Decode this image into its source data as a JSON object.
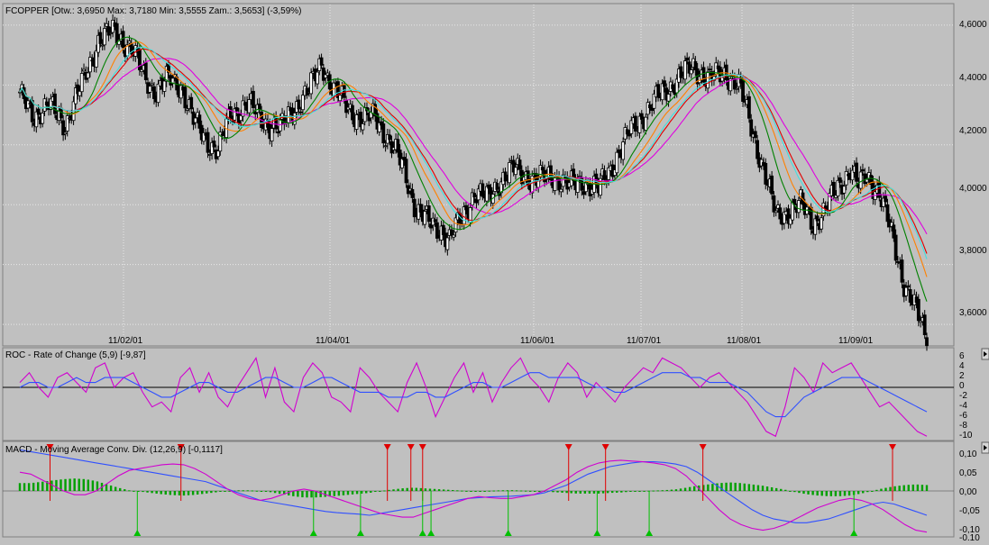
{
  "price_pane": {
    "title": "FCOPPER [Otw.: 3,6950  Max: 3,7180  Min: 3,5555  Zam.: 3,5653] (-3,59%)",
    "y_ticks": [
      "4,6000",
      "4,4000",
      "4,2000",
      "4,0000",
      "3,8000",
      "3,6000"
    ],
    "x_ticks": [
      "11/02/01",
      "11/04/01",
      "11/06/01",
      "11/07/01",
      "11/08/01",
      "11/09/01"
    ]
  },
  "roc_pane": {
    "title": "ROC - Rate of Change (5,9) [-9,87]",
    "y_ticks": [
      "6",
      "4",
      "2",
      "0",
      "-2",
      "-4",
      "-6",
      "-8",
      "-10"
    ]
  },
  "macd_pane": {
    "title": "MACD - Moving Average Conv. Div. (12,26,9) [-0,1117]",
    "y_ticks": [
      "0,10",
      "0,05",
      "0,00",
      "-0,05",
      "-0,10",
      "-0,10"
    ]
  },
  "colors": {
    "background": "#c0c0c0",
    "candle": "#000000",
    "ma_magenta": "#e000e0",
    "ma_red": "#e00000",
    "ma_orange": "#ff8000",
    "ma_green": "#008000",
    "ma_cyan": "#40e0e0",
    "roc": "#d000d0",
    "roc_signal": "#3050ff",
    "histogram": "#00a000",
    "sell": "#e00000",
    "buy": "#00c000"
  },
  "chart_data": [
    {
      "type": "candlestick",
      "title": "FCOPPER [Otw.: 3,6950  Max: 3,7180  Min: 3,5555  Zam.: 3,5653] (-3,59%)",
      "x_ticks": [
        "11/02/01",
        "11/04/01",
        "11/06/01",
        "11/07/01",
        "11/08/01",
        "11/09/01"
      ],
      "ylim": [
        3.54,
        4.66
      ],
      "close_path": [
        [
          0,
          4.36
        ],
        [
          7,
          4.3
        ],
        [
          14,
          4.33
        ],
        [
          22,
          4.27
        ],
        [
          30,
          4.4
        ],
        [
          38,
          4.55
        ],
        [
          46,
          4.58
        ],
        [
          54,
          4.52
        ],
        [
          60,
          4.43
        ],
        [
          66,
          4.38
        ],
        [
          72,
          4.42
        ],
        [
          78,
          4.4
        ],
        [
          84,
          4.28
        ],
        [
          90,
          4.22
        ],
        [
          96,
          4.18
        ],
        [
          102,
          4.3
        ],
        [
          110,
          4.34
        ],
        [
          118,
          4.28
        ],
        [
          126,
          4.25
        ],
        [
          132,
          4.32
        ],
        [
          140,
          4.38
        ],
        [
          146,
          4.48
        ],
        [
          152,
          4.38
        ],
        [
          160,
          4.32
        ],
        [
          166,
          4.28
        ],
        [
          172,
          4.3
        ],
        [
          178,
          4.22
        ],
        [
          186,
          4.12
        ],
        [
          192,
          3.98
        ],
        [
          198,
          3.94
        ],
        [
          204,
          3.92
        ],
        [
          208,
          3.88
        ],
        [
          214,
          3.96
        ],
        [
          220,
          4.04
        ],
        [
          226,
          4.02
        ],
        [
          232,
          4.08
        ],
        [
          240,
          4.12
        ],
        [
          250,
          4.08
        ],
        [
          258,
          4.1
        ],
        [
          266,
          4.06
        ],
        [
          272,
          4.08
        ],
        [
          280,
          4.05
        ],
        [
          288,
          4.15
        ],
        [
          296,
          4.25
        ],
        [
          304,
          4.32
        ],
        [
          312,
          4.38
        ],
        [
          318,
          4.42
        ],
        [
          326,
          4.46
        ],
        [
          334,
          4.42
        ],
        [
          342,
          4.44
        ],
        [
          348,
          4.4
        ],
        [
          354,
          4.26
        ],
        [
          360,
          4.12
        ],
        [
          366,
          3.96
        ],
        [
          372,
          3.98
        ],
        [
          378,
          4.0
        ],
        [
          384,
          3.94
        ],
        [
          390,
          3.98
        ],
        [
          396,
          4.06
        ],
        [
          402,
          4.12
        ],
        [
          406,
          4.06
        ],
        [
          410,
          4.1
        ],
        [
          416,
          4.04
        ],
        [
          422,
          3.9
        ],
        [
          428,
          3.74
        ],
        [
          434,
          3.64
        ],
        [
          438,
          3.57
        ]
      ]
    },
    {
      "type": "line",
      "title": "ROC - Rate of Change (5,9) [-9,87]",
      "ylim": [
        -10.5,
        7
      ],
      "y_ticks": [
        6,
        4,
        2,
        0,
        -2,
        -4,
        -6,
        -8,
        -10
      ],
      "series": [
        {
          "values": [
            1,
            3,
            0,
            -2,
            2,
            3,
            1,
            -1,
            4,
            5,
            0,
            2,
            3,
            -1,
            -4,
            -3,
            -5,
            2,
            4,
            -1,
            3,
            -2,
            -4,
            0,
            3,
            6,
            -2,
            4,
            -3,
            -5,
            2,
            5,
            3,
            -2,
            -3,
            -5,
            4,
            2,
            -1,
            -3,
            -5,
            1,
            5,
            0,
            -6,
            -2,
            2,
            5,
            -1,
            3,
            -3,
            1,
            4,
            6,
            2,
            0,
            -3,
            2,
            5,
            3,
            -2,
            1,
            -1,
            -3,
            0,
            2,
            4,
            3,
            6,
            5,
            4,
            2,
            0,
            2,
            3,
            1,
            -1,
            -3,
            -6,
            -9,
            -10,
            -4,
            4,
            2,
            -1,
            5,
            3,
            4,
            5,
            2,
            -1,
            -4,
            -3,
            -5,
            -7,
            -9,
            -10
          ]
        },
        {
          "values": [
            0,
            1,
            1,
            0,
            0,
            1,
            2,
            1,
            1,
            2,
            2,
            2,
            1,
            0,
            -1,
            -2,
            -2,
            -1,
            0,
            1,
            1,
            0,
            -1,
            -1,
            0,
            1,
            2,
            2,
            1,
            0,
            0,
            1,
            2,
            2,
            1,
            0,
            -1,
            -1,
            -1,
            -2,
            -2,
            -2,
            -1,
            -1,
            -2,
            -2,
            -1,
            0,
            1,
            1,
            0,
            0,
            1,
            2,
            3,
            3,
            2,
            2,
            2,
            2,
            1,
            0,
            0,
            -1,
            -1,
            0,
            1,
            2,
            3,
            3,
            3,
            2,
            2,
            1,
            1,
            1,
            0,
            -1,
            -3,
            -5,
            -6,
            -6,
            -4,
            -2,
            -1,
            0,
            1,
            2,
            2,
            2,
            1,
            0,
            -1,
            -2,
            -3,
            -4,
            -5
          ]
        }
      ]
    },
    {
      "type": "line",
      "title": "MACD - Moving Average Conv. Div. (12,26,9) [-0,1117]",
      "ylim": [
        -0.118,
        0.118
      ],
      "y_ticks": [
        0.1,
        0.05,
        0.0,
        -0.05,
        -0.1,
        -0.1
      ],
      "series": [
        {
          "values": [
            0.11,
            0.105,
            0.1,
            0.095,
            0.09,
            0.085,
            0.08,
            0.075,
            0.07,
            0.065,
            0.06,
            0.055,
            0.05,
            0.045,
            0.04,
            0.035,
            0.03,
            0.025,
            0.015,
            0.005,
            -0.005,
            -0.015,
            -0.025,
            -0.03,
            -0.035,
            -0.04,
            -0.045,
            -0.05,
            -0.055,
            -0.058,
            -0.06,
            -0.062,
            -0.065,
            -0.06,
            -0.055,
            -0.05,
            -0.045,
            -0.04,
            -0.035,
            -0.03,
            -0.025,
            -0.02,
            -0.018,
            -0.016,
            -0.015,
            -0.014,
            -0.012,
            -0.01,
            -0.005,
            0.005,
            0.015,
            0.03,
            0.045,
            0.055,
            0.065,
            0.07,
            0.075,
            0.078,
            0.078,
            0.076,
            0.072,
            0.065,
            0.05,
            0.03,
            0.01,
            -0.01,
            -0.03,
            -0.05,
            -0.065,
            -0.075,
            -0.08,
            -0.085,
            -0.085,
            -0.08,
            -0.075,
            -0.065,
            -0.055,
            -0.045,
            -0.035,
            -0.03,
            -0.035,
            -0.045,
            -0.055,
            -0.065
          ]
        },
        {
          "values": [
            0.05,
            0.045,
            0.03,
            0.015,
            0.0,
            -0.01,
            -0.01,
            0.0,
            0.02,
            0.04,
            0.055,
            0.06,
            0.065,
            0.07,
            0.072,
            0.07,
            0.06,
            0.045,
            0.025,
            0.005,
            -0.01,
            -0.02,
            -0.025,
            -0.02,
            -0.01,
            0.0,
            0.005,
            0.0,
            -0.01,
            -0.02,
            -0.03,
            -0.04,
            -0.05,
            -0.06,
            -0.065,
            -0.07,
            -0.07,
            -0.06,
            -0.05,
            -0.04,
            -0.03,
            -0.02,
            -0.015,
            -0.018,
            -0.02,
            -0.02,
            -0.015,
            -0.01,
            0.0,
            0.015,
            0.03,
            0.05,
            0.065,
            0.075,
            0.08,
            0.082,
            0.08,
            0.078,
            0.075,
            0.07,
            0.06,
            0.04,
            0.01,
            -0.02,
            -0.05,
            -0.075,
            -0.09,
            -0.1,
            -0.105,
            -0.1,
            -0.09,
            -0.075,
            -0.06,
            -0.045,
            -0.035,
            -0.025,
            -0.02,
            -0.025,
            -0.035,
            -0.05,
            -0.07,
            -0.09,
            -0.105,
            -0.11
          ]
        }
      ],
      "sell_markers_x": [
        18,
        96,
        219,
        233,
        240,
        327,
        349,
        407,
        520
      ],
      "buy_markers_x": [
        70,
        175,
        203,
        240,
        245,
        291,
        344,
        375,
        497
      ]
    }
  ]
}
